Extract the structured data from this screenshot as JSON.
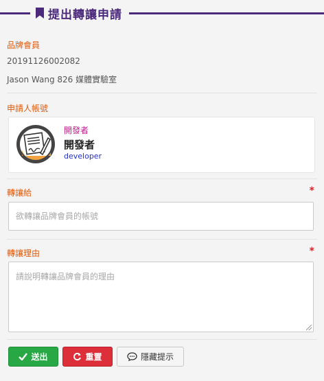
{
  "header": {
    "title": "提出轉讓申請",
    "icon": "bookmark-icon"
  },
  "brand_member": {
    "label": "品牌會員",
    "id": "20191126002082",
    "name": "Jason Wang 826 媒體實驗室"
  },
  "applicant": {
    "label": "申請人帳號",
    "role": "開發者",
    "name": "開發者",
    "account": "developer",
    "avatar_icon": "signature-document-icon"
  },
  "transfer_to": {
    "label": "轉讓給",
    "required_mark": "*",
    "placeholder": "欲轉讓品牌會員的帳號",
    "value": ""
  },
  "reason": {
    "label": "轉讓理由",
    "required_mark": "*",
    "placeholder": "請說明轉讓品牌會員的理由",
    "value": ""
  },
  "buttons": {
    "send": "送出",
    "reset": "重置",
    "hint": "隱藏提示"
  },
  "colors": {
    "accent": "#4b2a7c",
    "label": "#e05a0a",
    "send": "#27a844",
    "reset": "#dc2f3a"
  }
}
